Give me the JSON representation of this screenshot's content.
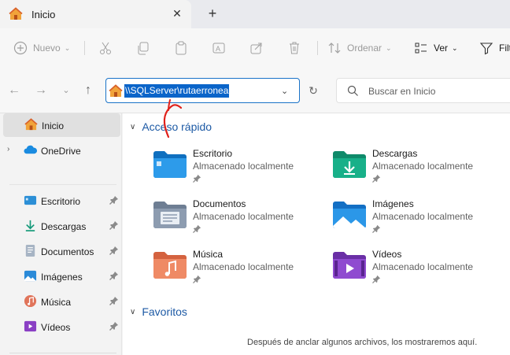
{
  "tab": {
    "title": "Inicio",
    "close": "✕",
    "new": "+"
  },
  "toolbar": {
    "new_label": "Nuevo",
    "sort_label": "Ordenar",
    "view_label": "Ver",
    "filter_label": "Filt"
  },
  "address": {
    "value": "\\\\SQLServer\\rutaerronea"
  },
  "search": {
    "placeholder": "Buscar en Inicio"
  },
  "sidebar": {
    "items": [
      {
        "label": "Inicio",
        "icon": "home-icon"
      },
      {
        "label": "OneDrive",
        "icon": "cloud-icon"
      },
      {
        "label": "Escritorio",
        "icon": "desktop-folder-icon"
      },
      {
        "label": "Descargas",
        "icon": "download-icon"
      },
      {
        "label": "Documentos",
        "icon": "document-icon"
      },
      {
        "label": "Imágenes",
        "icon": "picture-icon"
      },
      {
        "label": "Música",
        "icon": "music-icon"
      },
      {
        "label": "Vídeos",
        "icon": "video-icon"
      }
    ]
  },
  "main": {
    "quick_access_title": "Acceso rápido",
    "favorites_title": "Favoritos",
    "items": [
      {
        "name": "Escritorio",
        "sub": "Almacenado localmente"
      },
      {
        "name": "Descargas",
        "sub": "Almacenado localmente"
      },
      {
        "name": "Documentos",
        "sub": "Almacenado localmente"
      },
      {
        "name": "Imágenes",
        "sub": "Almacenado localmente"
      },
      {
        "name": "Música",
        "sub": "Almacenado localmente"
      },
      {
        "name": "Vídeos",
        "sub": "Almacenado localmente"
      }
    ],
    "favorites_empty": "Después de anclar algunos archivos, los mostraremos aquí."
  },
  "colors": {
    "accent": "#0a64c9",
    "section": "#1d5aa5",
    "annotation": "#e0201a"
  }
}
